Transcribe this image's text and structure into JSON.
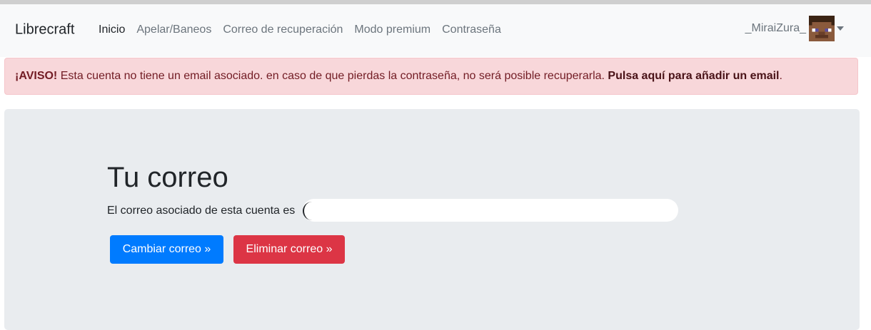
{
  "navbar": {
    "brand": "Librecraft",
    "links": [
      {
        "label": "Inicio",
        "active": true
      },
      {
        "label": "Apelar/Baneos",
        "active": false
      },
      {
        "label": "Correo de recuperación",
        "active": false
      },
      {
        "label": "Modo premium",
        "active": false
      },
      {
        "label": "Contraseña",
        "active": false
      }
    ],
    "user": {
      "name": "_MiraiZura_",
      "avatar_icon": "minecraft-skin-head-icon",
      "dropdown_icon": "caret-down-icon"
    }
  },
  "alert": {
    "strong": "¡AVISO!",
    "text": " Esta cuenta no tiene un email asociado. en caso de que pierdas la contraseña, no será posible recuperarla. ",
    "link": "Pulsa aquí para añadir un email",
    "end": "."
  },
  "main": {
    "title": "Tu correo",
    "description": "El correo asociado de esta cuenta es",
    "change_button": "Cambiar correo »",
    "delete_button": "Eliminar correo »"
  },
  "colors": {
    "primary": "#007bff",
    "danger": "#dc3545",
    "alert_bg": "#f8d7da",
    "alert_text": "#721c24",
    "jumbotron_bg": "#e9ecef",
    "navbar_bg": "#f8f9fa"
  }
}
